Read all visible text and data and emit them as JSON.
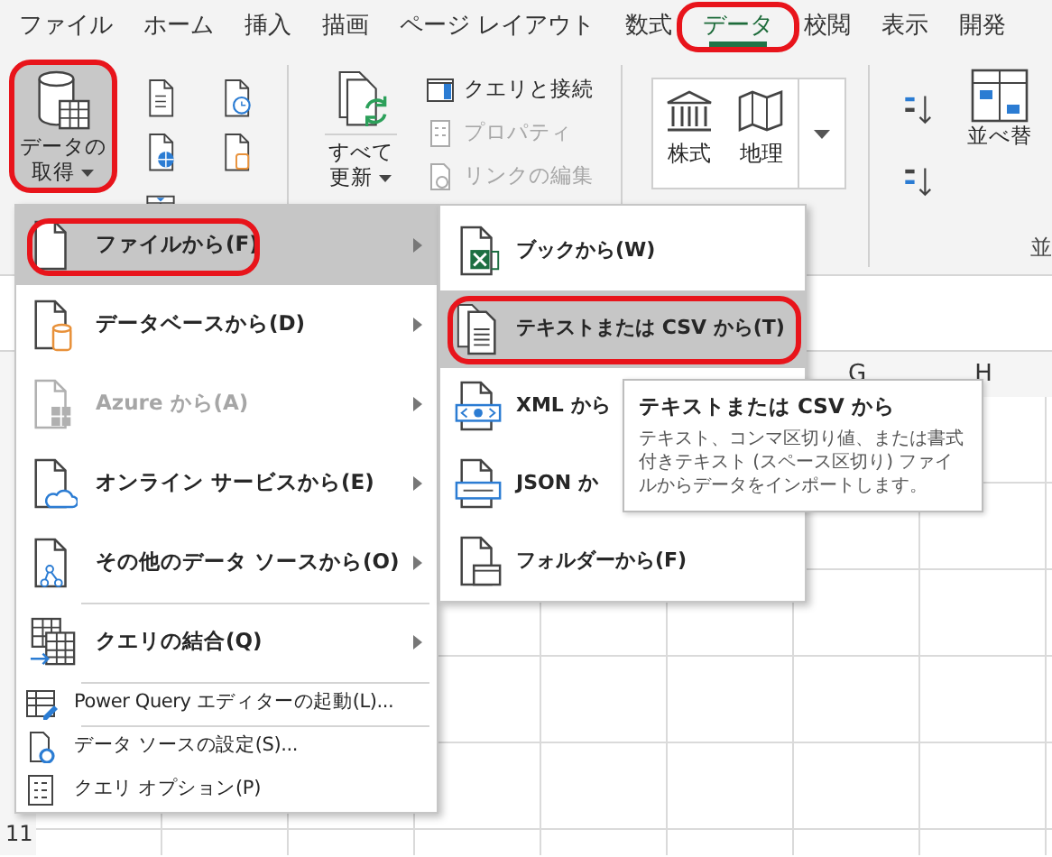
{
  "tabs": [
    {
      "label": "ファイル",
      "selected": false,
      "highlighted": false
    },
    {
      "label": "ホーム",
      "selected": false,
      "highlighted": false
    },
    {
      "label": "挿入",
      "selected": false,
      "highlighted": false
    },
    {
      "label": "描画",
      "selected": false,
      "highlighted": false
    },
    {
      "label": "ページ レイアウト",
      "selected": false,
      "highlighted": false
    },
    {
      "label": "数式",
      "selected": false,
      "highlighted": false
    },
    {
      "label": "データ",
      "selected": true,
      "highlighted": true
    },
    {
      "label": "校閲",
      "selected": false,
      "highlighted": false
    },
    {
      "label": "表示",
      "selected": false,
      "highlighted": false
    },
    {
      "label": "開発",
      "selected": false,
      "highlighted": false
    }
  ],
  "ribbon": {
    "get_data": {
      "label": "データの取得",
      "pressed": true,
      "highlighted": true
    },
    "refresh_all": {
      "label": "すべて更新"
    },
    "query_commands": [
      {
        "label": "クエリと接続",
        "disabled": false
      },
      {
        "label": "プロパティ",
        "disabled": true
      },
      {
        "label": "リンクの編集",
        "disabled": true
      }
    ],
    "data_types": [
      {
        "label": "株式"
      },
      {
        "label": "地理"
      }
    ],
    "sort": {
      "label": "並べ替",
      "group_label": "並"
    }
  },
  "get_data_menu": [
    {
      "label": "ファイルから(F)",
      "kind": "large",
      "submenu": true,
      "selected": true,
      "highlighted": true,
      "disabled": false,
      "divider_before": false
    },
    {
      "label": "データベースから(D)",
      "kind": "large",
      "submenu": true,
      "selected": false,
      "highlighted": false,
      "disabled": false,
      "divider_before": false
    },
    {
      "label": "Azure から(A)",
      "kind": "large",
      "submenu": true,
      "selected": false,
      "highlighted": false,
      "disabled": true,
      "divider_before": false
    },
    {
      "label": "オンライン サービスから(E)",
      "kind": "large",
      "submenu": true,
      "selected": false,
      "highlighted": false,
      "disabled": false,
      "divider_before": false
    },
    {
      "label": "その他のデータ ソースから(O)",
      "kind": "large",
      "submenu": true,
      "selected": false,
      "highlighted": false,
      "disabled": false,
      "divider_before": false
    },
    {
      "label": "クエリの結合(Q)",
      "kind": "large",
      "submenu": true,
      "selected": false,
      "highlighted": false,
      "disabled": false,
      "divider_before": true
    },
    {
      "label": "Power Query エディターの起動(L)...",
      "kind": "small",
      "submenu": false,
      "selected": false,
      "highlighted": false,
      "disabled": false,
      "divider_before": true
    },
    {
      "label": "データ ソースの設定(S)...",
      "kind": "small",
      "submenu": false,
      "selected": false,
      "highlighted": false,
      "disabled": false,
      "divider_before": true
    },
    {
      "label": "クエリ オプション(P)",
      "kind": "small",
      "submenu": false,
      "selected": false,
      "highlighted": false,
      "disabled": false,
      "divider_before": false
    }
  ],
  "file_submenu": [
    {
      "label": "ブックから(W)",
      "selected": false,
      "highlighted": false
    },
    {
      "label": "テキストまたは CSV から(T)",
      "selected": true,
      "highlighted": true
    },
    {
      "label": "XML から",
      "selected": false,
      "highlighted": false
    },
    {
      "label": "JSON か",
      "selected": false,
      "highlighted": false
    },
    {
      "label": "フォルダーから(F)",
      "selected": false,
      "highlighted": false
    }
  ],
  "tooltip": {
    "title": "テキストまたは CSV から",
    "text": "テキスト、コンマ区切り値、または書式付きテキスト (スペース区切り) ファイルからデータをインポートします。"
  },
  "sheet": {
    "column_headers": [
      "G",
      "H"
    ],
    "row_headers": [
      "11"
    ]
  }
}
